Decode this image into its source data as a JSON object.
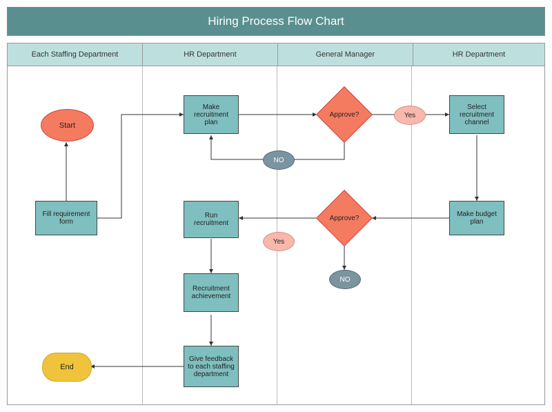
{
  "title": "Hiring Process Flow Chart",
  "lanes": {
    "l1": "Each Staffing Department",
    "l2": "HR Department",
    "l3": "General Manager",
    "l4": "HR Department"
  },
  "nodes": {
    "start": "Start",
    "fill_form": "Fill requirement form",
    "make_plan": "Make recruitment plan",
    "approve1": "Approve?",
    "yes1": "Yes",
    "no1": "NO",
    "select_channel": "Select recruitment channel",
    "budget": "Make budget plan",
    "approve2": "Approve?",
    "yes2": "Yes",
    "no2": "NO",
    "run": "Run recruitment",
    "achievement": "Recruitment achievement",
    "feedback": "Give feedback to each staffing department",
    "end": "End"
  }
}
